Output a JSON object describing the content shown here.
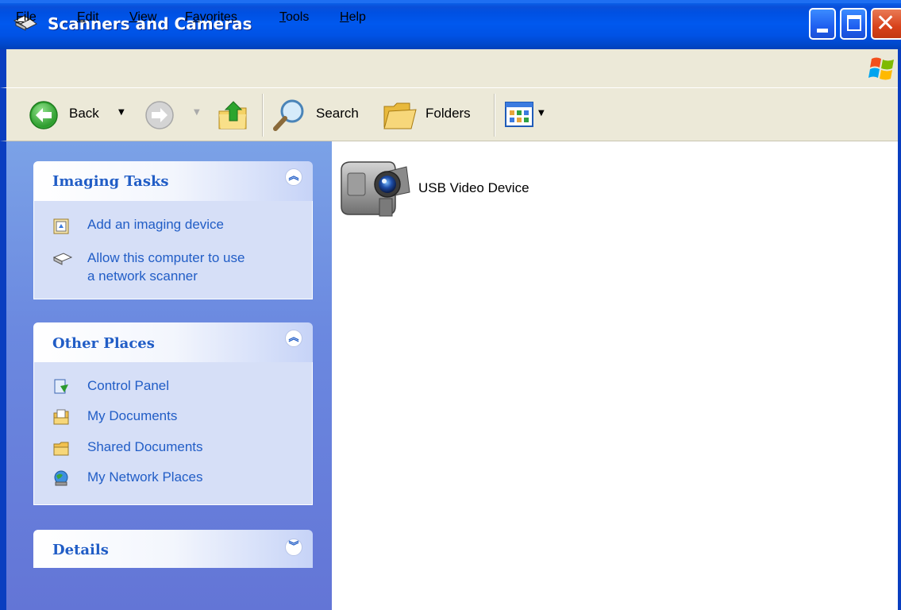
{
  "window": {
    "title": "Scanners and Cameras"
  },
  "menu": {
    "file": {
      "u": "F",
      "rest": "ile"
    },
    "edit": {
      "u": "E",
      "rest": "dit"
    },
    "view": {
      "u": "V",
      "rest": "iew"
    },
    "favorites": {
      "pre": "F",
      "u": "a",
      "rest": "vorites"
    },
    "tools": {
      "u": "T",
      "rest": "ools"
    },
    "help": {
      "u": "H",
      "rest": "elp"
    }
  },
  "toolbar": {
    "back_label": "Back",
    "search_label": "Search",
    "folders_label": "Folders"
  },
  "sidebar": {
    "imaging_tasks": {
      "title": "Imaging Tasks",
      "items": [
        {
          "label": "Add an imaging device"
        },
        {
          "label_line1": "Allow this computer to use",
          "label_line2": "a network scanner"
        }
      ]
    },
    "other_places": {
      "title": "Other Places",
      "items": [
        {
          "label": "Control Panel"
        },
        {
          "label": "My Documents"
        },
        {
          "label": "Shared Documents"
        },
        {
          "label": "My Network Places"
        }
      ]
    },
    "details": {
      "title": "Details"
    }
  },
  "content": {
    "devices": [
      {
        "label": "USB Video Device",
        "icon": "video-camera-icon"
      }
    ]
  },
  "colors": {
    "titlebar": "#0054e3",
    "sidebar_bg": "#6d8ee0",
    "panel_body": "#d6dff7",
    "link": "#215dc6"
  }
}
